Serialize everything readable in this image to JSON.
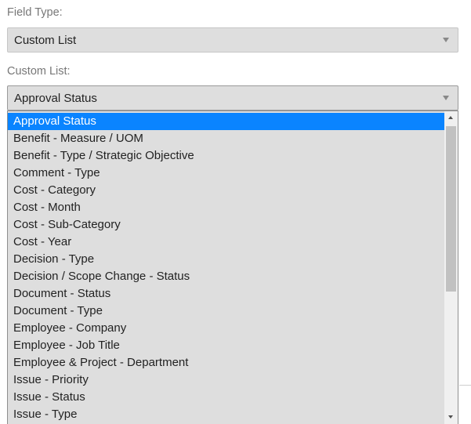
{
  "field_type": {
    "label": "Field Type:",
    "value": "Custom List"
  },
  "custom_list": {
    "label": "Custom List:",
    "value": "Approval Status",
    "options": [
      "Approval Status",
      "Benefit - Measure / UOM",
      "Benefit - Type / Strategic Objective",
      "Comment - Type",
      "Cost - Category",
      "Cost - Month",
      "Cost - Sub-Category",
      "Cost - Year",
      "Decision - Type",
      "Decision / Scope Change - Status",
      "Document - Status",
      "Document - Type",
      "Employee - Company",
      "Employee - Job Title",
      "Employee & Project - Department",
      "Issue - Priority",
      "Issue - Status",
      "Issue - Type"
    ],
    "selected_index": 0
  },
  "colors": {
    "highlight": "#0a84ff",
    "control_background": "#dedede",
    "label_text": "#777777"
  },
  "icons": {
    "dropdown": "chevron-down-icon",
    "scroll_up": "scroll-up-arrow-icon",
    "scroll_down": "scroll-down-arrow-icon"
  }
}
